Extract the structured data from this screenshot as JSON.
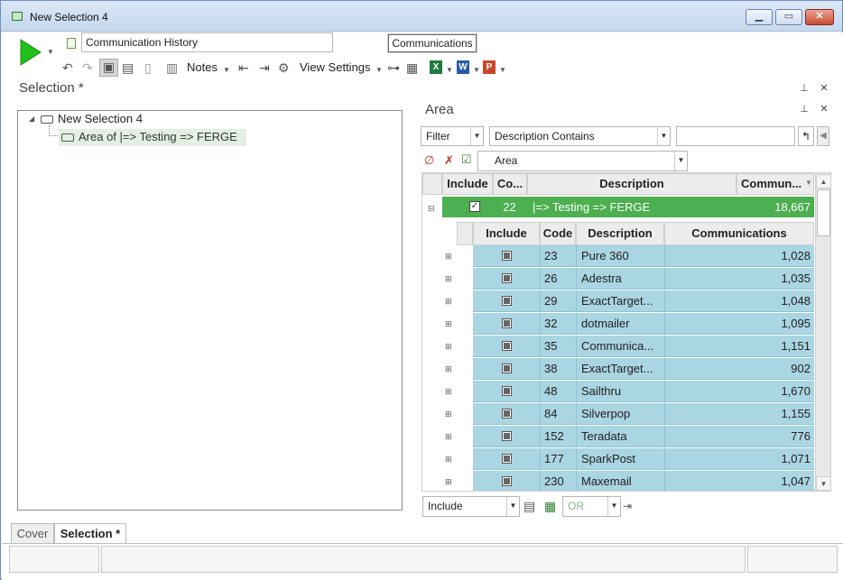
{
  "window": {
    "title": "New Selection 4"
  },
  "toolbar": {
    "name_value": "Communication History",
    "table_label": "Communications",
    "notes_label": "Notes",
    "view_settings_label": "View Settings"
  },
  "selection_panel": {
    "title": "Selection *",
    "tree": {
      "root": "New Selection 4",
      "child": "Area of |=> Testing => FERGE"
    }
  },
  "area_panel": {
    "title": "Area",
    "filter_label": "Filter",
    "filter_mode": "Description Contains",
    "filter_value": "",
    "field_select": "Area",
    "grid": {
      "columns": [
        "Include",
        "Co...",
        "Description",
        "Commun..."
      ],
      "parent_row": {
        "include": true,
        "code": "22",
        "description": "|=> Testing => FERGE",
        "communications": "18,667"
      },
      "child_columns": [
        "Include",
        "Code",
        "Description",
        "Communications"
      ],
      "child_rows": [
        {
          "code": "23",
          "description": "Pure 360",
          "communications": "1,028"
        },
        {
          "code": "26",
          "description": "Adestra",
          "communications": "1,035"
        },
        {
          "code": "29",
          "description": "ExactTarget...",
          "communications": "1,048"
        },
        {
          "code": "32",
          "description": "dotmailer",
          "communications": "1,095"
        },
        {
          "code": "35",
          "description": "Communica...",
          "communications": "1,151"
        },
        {
          "code": "38",
          "description": "ExactTarget...",
          "communications": "902"
        },
        {
          "code": "48",
          "description": "Sailthru",
          "communications": "1,670"
        },
        {
          "code": "84",
          "description": "Silverpop",
          "communications": "1,155"
        },
        {
          "code": "152",
          "description": "Teradata",
          "communications": "776"
        },
        {
          "code": "177",
          "description": "SparkPost",
          "communications": "1,071"
        },
        {
          "code": "230",
          "description": "Maxemail",
          "communications": "1,047"
        }
      ]
    },
    "footer": {
      "include_select": "Include",
      "operator_select": "OR"
    }
  },
  "tabs": [
    "Cover",
    "Selection *"
  ],
  "colors": {
    "highlight_green": "#4caf50",
    "row_blue": "#aad5e2",
    "play_green": "#22c01a"
  }
}
